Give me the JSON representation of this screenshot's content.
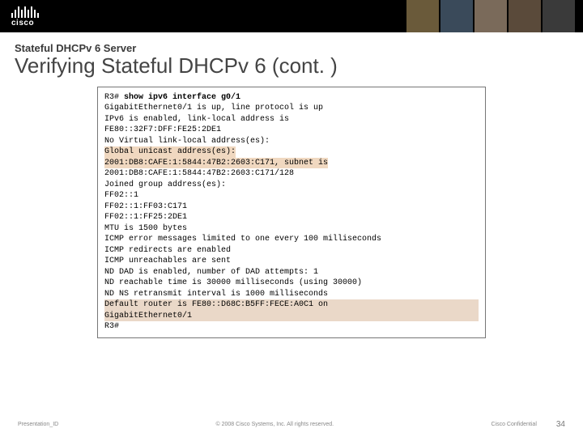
{
  "brand": {
    "name": "cisco"
  },
  "heading": {
    "kicker": "Stateful DHCPv 6 Server",
    "title": "Verifying Stateful DHCPv 6 (cont. )"
  },
  "terminal": {
    "l01a": "R3# ",
    "l01b": "show ipv6 interface g0/1",
    "l02": "GigabitEthernet0/1 is up, line protocol is up",
    "l03": "  IPv6 is enabled, link-local address is",
    "l04": "FE80::32F7:DFF:FE25:2DE1",
    "l05": "  No Virtual link-local address(es):",
    "l06": "  Global unicast address(es):",
    "l07": "    2001:DB8:CAFE:1:5844:47B2:2603:C171, subnet is",
    "l08": "2001:DB8:CAFE:1:5844:47B2:2603:C171/128",
    "l09": "  Joined group address(es):",
    "l10": "    FF02::1",
    "l11": "    FF02::1:FF03:C171",
    "l12": "    FF02::1:FF25:2DE1",
    "l13": "  MTU is 1500 bytes",
    "l14": "  ICMP error messages limited to one every 100 milliseconds",
    "l15": "  ICMP redirects are enabled",
    "l16": "  ICMP unreachables are sent",
    "l17": "  ND DAD is enabled, number of DAD attempts: 1",
    "l18": "  ND reachable time is 30000 milliseconds (using 30000)",
    "l19": "  ND NS retransmit interval is 1000 milliseconds",
    "l20": "  Default router is FE80::D68C:B5FF:FECE:A0C1 on",
    "l21": "GigabitEthernet0/1",
    "l22": "R3#"
  },
  "footer": {
    "left": "Presentation_ID",
    "mid": "© 2008 Cisco Systems, Inc. All rights reserved.",
    "conf": "Cisco Confidential",
    "page": "34"
  }
}
